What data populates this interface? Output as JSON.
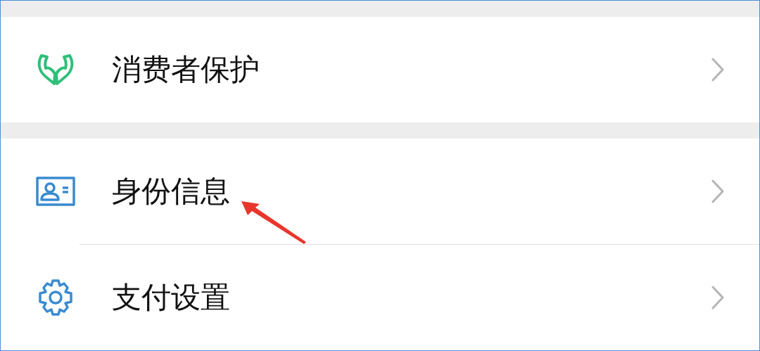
{
  "groups": [
    {
      "items": [
        {
          "label": "消费者保护",
          "kind": "hands"
        }
      ]
    },
    {
      "items": [
        {
          "label": "身份信息",
          "kind": "card"
        },
        {
          "label": "支付设置",
          "kind": "gear"
        }
      ]
    }
  ]
}
